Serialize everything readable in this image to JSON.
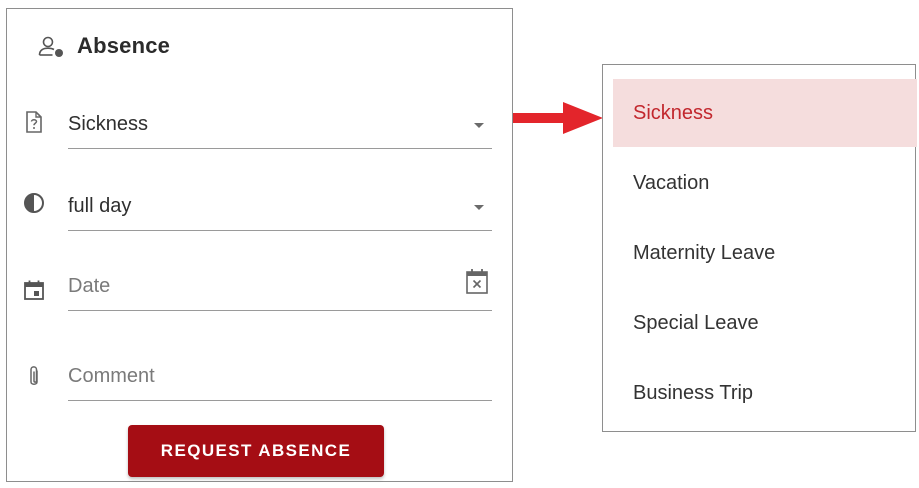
{
  "form": {
    "title": "Absence",
    "absence_type": {
      "icon": "help-document-icon",
      "value": "Sickness"
    },
    "duration": {
      "icon": "half-circle-icon",
      "value": "full day"
    },
    "date": {
      "icon": "calendar-icon",
      "placeholder": "Date",
      "trailing_icon": "clear-calendar-icon"
    },
    "comment": {
      "icon": "paperclip-icon",
      "placeholder": "Comment"
    },
    "submit_label": "REQUEST ABSENCE"
  },
  "options_panel": {
    "items": [
      {
        "label": "Sickness",
        "selected": true
      },
      {
        "label": "Vacation",
        "selected": false
      },
      {
        "label": "Maternity Leave",
        "selected": false
      },
      {
        "label": "Special Leave",
        "selected": false
      },
      {
        "label": "Business Trip",
        "selected": false
      }
    ]
  },
  "colors": {
    "accent": "#a50d14",
    "selected_text": "#c2272d",
    "selected_bg": "#f5dddd",
    "arrow": "#e3252b"
  }
}
